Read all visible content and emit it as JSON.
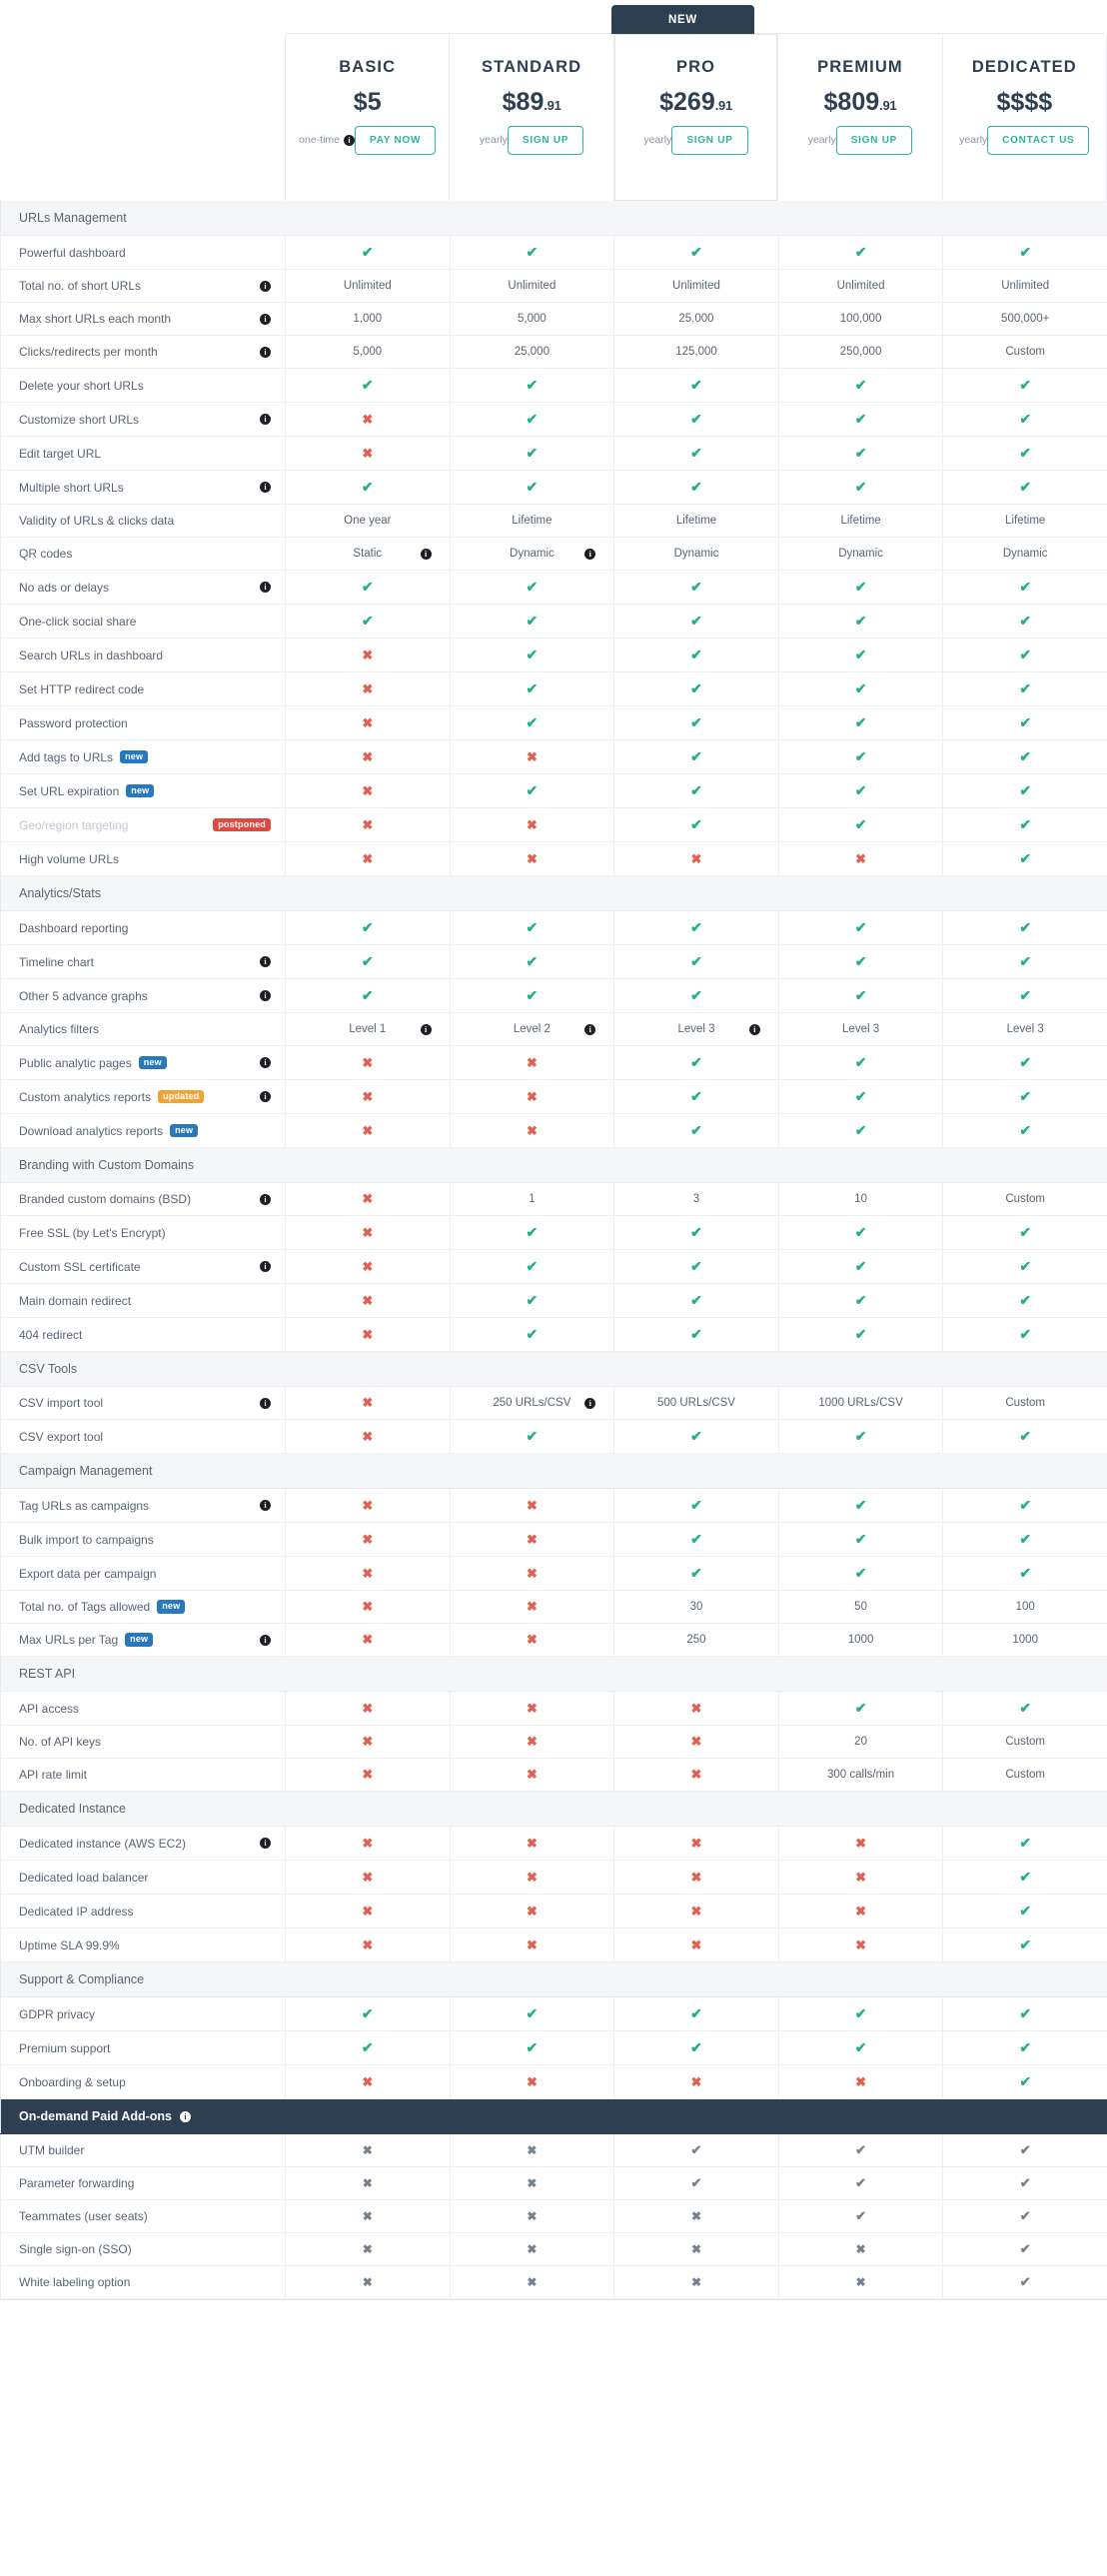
{
  "header": {
    "new_badge": "NEW",
    "plans": [
      {
        "name": "BASIC",
        "price": "$5",
        "cents": "",
        "period": "one-time",
        "period_info": true,
        "cta": "PAY NOW",
        "featured": false
      },
      {
        "name": "STANDARD",
        "price": "$89",
        "cents": ".91",
        "period": "yearly",
        "period_info": false,
        "cta": "SIGN UP",
        "featured": false
      },
      {
        "name": "PRO",
        "price": "$269",
        "cents": ".91",
        "period": "yearly",
        "period_info": false,
        "cta": "SIGN UP",
        "featured": true
      },
      {
        "name": "PREMIUM",
        "price": "$809",
        "cents": ".91",
        "period": "yearly",
        "period_info": false,
        "cta": "SIGN UP",
        "featured": false
      },
      {
        "name": "DEDICATED",
        "price": "$$$$",
        "cents": "",
        "period": "yearly",
        "period_info": false,
        "cta": "CONTACT US",
        "featured": false
      }
    ]
  },
  "icons": {
    "info": "i",
    "tick": "✔",
    "cross": "✖"
  },
  "colors": {
    "accent_teal": "#2bb5a0",
    "tick_green": "#21b185",
    "cross_red": "#e0614f",
    "dark_navy": "#2e3f52",
    "badge_new": "#2878bd",
    "badge_updated": "#f0a437",
    "badge_postponed": "#e04a3c",
    "section_bg": "#f5f6f7",
    "muted_gray": "#76818e"
  },
  "sections": [
    {
      "title": "URLs Management",
      "dark": false,
      "info": false,
      "rows": [
        {
          "label": "Powerful dashboard",
          "info": false,
          "badge": null,
          "values": [
            "tick",
            "tick",
            "tick",
            "tick",
            "tick"
          ]
        },
        {
          "label": "Total no. of short URLs",
          "info": true,
          "badge": null,
          "values": [
            "Unlimited",
            "Unlimited",
            "Unlimited",
            "Unlimited",
            "Unlimited"
          ]
        },
        {
          "label": "Max short URLs each month",
          "info": true,
          "badge": null,
          "values": [
            "1,000",
            "5,000",
            "25,000",
            "100,000",
            "500,000+"
          ]
        },
        {
          "label": "Clicks/redirects per month",
          "info": true,
          "badge": null,
          "values": [
            "5,000",
            "25,000",
            "125,000",
            "250,000",
            "Custom"
          ]
        },
        {
          "label": "Delete your short URLs",
          "info": false,
          "badge": null,
          "values": [
            "tick",
            "tick",
            "tick",
            "tick",
            "tick"
          ]
        },
        {
          "label": "Customize short URLs",
          "info": true,
          "badge": null,
          "values": [
            "cross",
            "tick",
            "tick",
            "tick",
            "tick"
          ]
        },
        {
          "label": "Edit target URL",
          "info": false,
          "badge": null,
          "values": [
            "cross",
            "tick",
            "tick",
            "tick",
            "tick"
          ]
        },
        {
          "label": "Multiple short URLs",
          "info": true,
          "badge": null,
          "values": [
            "tick",
            "tick",
            "tick",
            "tick",
            "tick"
          ]
        },
        {
          "label": "Validity of URLs & clicks data",
          "info": false,
          "badge": null,
          "values": [
            "One year",
            "Lifetime",
            "Lifetime",
            "Lifetime",
            "Lifetime"
          ]
        },
        {
          "label": "QR codes",
          "info": false,
          "badge": null,
          "values": [
            "Static",
            "Dynamic",
            "Dynamic",
            "Dynamic",
            "Dynamic"
          ],
          "value_info": [
            true,
            true,
            false,
            false,
            false
          ]
        },
        {
          "label": "No ads or delays",
          "info": true,
          "badge": null,
          "values": [
            "tick",
            "tick",
            "tick",
            "tick",
            "tick"
          ]
        },
        {
          "label": "One-click social share",
          "info": false,
          "badge": null,
          "values": [
            "tick",
            "tick",
            "tick",
            "tick",
            "tick"
          ]
        },
        {
          "label": "Search URLs in dashboard",
          "info": false,
          "badge": null,
          "values": [
            "cross",
            "tick",
            "tick",
            "tick",
            "tick"
          ]
        },
        {
          "label": "Set HTTP redirect code",
          "info": false,
          "badge": null,
          "values": [
            "cross",
            "tick",
            "tick",
            "tick",
            "tick"
          ]
        },
        {
          "label": "Password protection",
          "info": false,
          "badge": null,
          "values": [
            "cross",
            "tick",
            "tick",
            "tick",
            "tick"
          ]
        },
        {
          "label": "Add tags to URLs",
          "info": false,
          "badge": {
            "text": "new",
            "kind": "new"
          },
          "values": [
            "cross",
            "cross",
            "tick",
            "tick",
            "tick"
          ]
        },
        {
          "label": "Set URL expiration",
          "info": false,
          "badge": {
            "text": "new",
            "kind": "new"
          },
          "values": [
            "cross",
            "tick",
            "tick",
            "tick",
            "tick"
          ]
        },
        {
          "label": "Geo/region targeting",
          "info": false,
          "muted": true,
          "badge": {
            "text": "postponed",
            "kind": "postponed"
          },
          "values": [
            "cross",
            "cross",
            "tick",
            "tick",
            "tick"
          ]
        },
        {
          "label": "High volume URLs",
          "info": false,
          "badge": null,
          "values": [
            "cross",
            "cross",
            "cross",
            "cross",
            "tick"
          ]
        }
      ]
    },
    {
      "title": "Analytics/Stats",
      "dark": false,
      "info": false,
      "rows": [
        {
          "label": "Dashboard reporting",
          "info": false,
          "badge": null,
          "values": [
            "tick",
            "tick",
            "tick",
            "tick",
            "tick"
          ]
        },
        {
          "label": "Timeline chart",
          "info": true,
          "badge": null,
          "values": [
            "tick",
            "tick",
            "tick",
            "tick",
            "tick"
          ]
        },
        {
          "label": "Other 5 advance graphs",
          "info": true,
          "badge": null,
          "values": [
            "tick",
            "tick",
            "tick",
            "tick",
            "tick"
          ]
        },
        {
          "label": "Analytics filters",
          "info": false,
          "badge": null,
          "values": [
            "Level 1",
            "Level 2",
            "Level 3",
            "Level 3",
            "Level 3"
          ],
          "value_info": [
            true,
            true,
            true,
            false,
            false
          ]
        },
        {
          "label": "Public analytic pages",
          "info": true,
          "badge": {
            "text": "new",
            "kind": "new"
          },
          "values": [
            "cross",
            "cross",
            "tick",
            "tick",
            "tick"
          ]
        },
        {
          "label": "Custom analytics reports",
          "info": true,
          "badge": {
            "text": "updated",
            "kind": "updated"
          },
          "values": [
            "cross",
            "cross",
            "tick",
            "tick",
            "tick"
          ]
        },
        {
          "label": "Download analytics reports",
          "info": false,
          "badge": {
            "text": "new",
            "kind": "new"
          },
          "values": [
            "cross",
            "cross",
            "tick",
            "tick",
            "tick"
          ]
        }
      ]
    },
    {
      "title": "Branding with Custom Domains",
      "dark": false,
      "info": false,
      "rows": [
        {
          "label": "Branded custom domains (BSD)",
          "info": true,
          "badge": null,
          "values": [
            "cross",
            "1",
            "3",
            "10",
            "Custom"
          ]
        },
        {
          "label": "Free SSL (by Let's Encrypt)",
          "info": false,
          "badge": null,
          "values": [
            "cross",
            "tick",
            "tick",
            "tick",
            "tick"
          ]
        },
        {
          "label": "Custom SSL certificate",
          "info": true,
          "badge": null,
          "values": [
            "cross",
            "tick",
            "tick",
            "tick",
            "tick"
          ]
        },
        {
          "label": "Main domain redirect",
          "info": false,
          "badge": null,
          "values": [
            "cross",
            "tick",
            "tick",
            "tick",
            "tick"
          ]
        },
        {
          "label": "404 redirect",
          "info": false,
          "badge": null,
          "values": [
            "cross",
            "tick",
            "tick",
            "tick",
            "tick"
          ]
        }
      ]
    },
    {
      "title": "CSV Tools",
      "dark": false,
      "info": false,
      "rows": [
        {
          "label": "CSV import tool",
          "info": true,
          "badge": null,
          "values": [
            "cross",
            "250 URLs/CSV",
            "500 URLs/CSV",
            "1000 URLs/CSV",
            "Custom"
          ],
          "value_info": [
            false,
            true,
            false,
            false,
            false
          ]
        },
        {
          "label": "CSV export tool",
          "info": false,
          "badge": null,
          "values": [
            "cross",
            "tick",
            "tick",
            "tick",
            "tick"
          ]
        }
      ]
    },
    {
      "title": "Campaign Management",
      "dark": false,
      "info": false,
      "rows": [
        {
          "label": "Tag URLs as campaigns",
          "info": true,
          "badge": null,
          "values": [
            "cross",
            "cross",
            "tick",
            "tick",
            "tick"
          ]
        },
        {
          "label": "Bulk import to campaigns",
          "info": false,
          "badge": null,
          "values": [
            "cross",
            "cross",
            "tick",
            "tick",
            "tick"
          ]
        },
        {
          "label": "Export data per campaign",
          "info": false,
          "badge": null,
          "values": [
            "cross",
            "cross",
            "tick",
            "tick",
            "tick"
          ]
        },
        {
          "label": "Total no. of Tags allowed",
          "info": false,
          "badge": {
            "text": "new",
            "kind": "new"
          },
          "values": [
            "cross",
            "cross",
            "30",
            "50",
            "100"
          ]
        },
        {
          "label": "Max URLs per Tag",
          "info": true,
          "badge": {
            "text": "new",
            "kind": "new"
          },
          "values": [
            "cross",
            "cross",
            "250",
            "1000",
            "1000"
          ]
        }
      ]
    },
    {
      "title": "REST API",
      "dark": false,
      "info": false,
      "rows": [
        {
          "label": "API access",
          "info": false,
          "badge": null,
          "values": [
            "cross",
            "cross",
            "cross",
            "tick",
            "tick"
          ]
        },
        {
          "label": "No. of API keys",
          "info": false,
          "badge": null,
          "values": [
            "cross",
            "cross",
            "cross",
            "20",
            "Custom"
          ]
        },
        {
          "label": "API rate limit",
          "info": false,
          "badge": null,
          "values": [
            "cross",
            "cross",
            "cross",
            "300 calls/min",
            "Custom"
          ]
        }
      ]
    },
    {
      "title": "Dedicated Instance",
      "dark": false,
      "info": false,
      "rows": [
        {
          "label": "Dedicated instance (AWS EC2)",
          "info": true,
          "badge": null,
          "values": [
            "cross",
            "cross",
            "cross",
            "cross",
            "tick"
          ]
        },
        {
          "label": "Dedicated load balancer",
          "info": false,
          "badge": null,
          "values": [
            "cross",
            "cross",
            "cross",
            "cross",
            "tick"
          ]
        },
        {
          "label": "Dedicated IP address",
          "info": false,
          "badge": null,
          "values": [
            "cross",
            "cross",
            "cross",
            "cross",
            "tick"
          ]
        },
        {
          "label": "Uptime SLA 99.9%",
          "info": false,
          "badge": null,
          "values": [
            "cross",
            "cross",
            "cross",
            "cross",
            "tick"
          ]
        }
      ]
    },
    {
      "title": "Support & Compliance",
      "dark": false,
      "info": false,
      "rows": [
        {
          "label": "GDPR privacy",
          "info": false,
          "badge": null,
          "values": [
            "tick",
            "tick",
            "tick",
            "tick",
            "tick"
          ]
        },
        {
          "label": "Premium support",
          "info": false,
          "badge": null,
          "values": [
            "tick",
            "tick",
            "tick",
            "tick",
            "tick"
          ]
        },
        {
          "label": "Onboarding & setup",
          "info": false,
          "badge": null,
          "values": [
            "cross",
            "cross",
            "cross",
            "cross",
            "tick"
          ]
        }
      ]
    },
    {
      "title": "On-demand Paid Add-ons",
      "dark": true,
      "info": true,
      "rows": [
        {
          "label": "UTM builder",
          "info": false,
          "badge": null,
          "gray": true,
          "values": [
            "cross",
            "cross",
            "tick",
            "tick",
            "tick"
          ]
        },
        {
          "label": "Parameter forwarding",
          "info": false,
          "badge": null,
          "gray": true,
          "values": [
            "cross",
            "cross",
            "tick",
            "tick",
            "tick"
          ]
        },
        {
          "label": "Teammates (user seats)",
          "info": false,
          "badge": null,
          "gray": true,
          "values": [
            "cross",
            "cross",
            "cross",
            "tick",
            "tick"
          ]
        },
        {
          "label": "Single sign-on (SSO)",
          "info": false,
          "badge": null,
          "gray": true,
          "values": [
            "cross",
            "cross",
            "cross",
            "cross",
            "tick"
          ]
        },
        {
          "label": "White labeling option",
          "info": false,
          "badge": null,
          "gray": true,
          "values": [
            "cross",
            "cross",
            "cross",
            "cross",
            "tick"
          ]
        }
      ]
    }
  ]
}
